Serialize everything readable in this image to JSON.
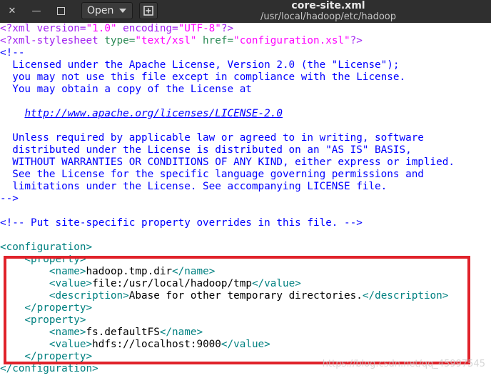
{
  "window": {
    "title": "core-site.xml",
    "path": "/usr/local/hadoop/etc/hadoop",
    "open_label": "Open",
    "icons": {
      "close": "close-icon",
      "minimize": "minimize-icon",
      "maximize": "maximize-icon",
      "new_tab": "new-document-icon"
    }
  },
  "code": {
    "l1": {
      "a": "<?xml version=",
      "b": "\"1.0\"",
      "c": " encoding=",
      "d": "\"UTF-8\"",
      "e": "?>"
    },
    "l2": {
      "a": "<?xml-stylesheet ",
      "b": "type=",
      "c": "\"text/xsl\"",
      "d": " href=",
      "e": "\"configuration.xsl\"",
      "f": "?>"
    },
    "l3": "<!--",
    "l4": "  Licensed under the Apache License, Version 2.0 (the \"License\");",
    "l5": "  you may not use this file except in compliance with the License.",
    "l6": "  You may obtain a copy of the License at",
    "l7": "",
    "l8": {
      "pre": "    ",
      "link": "http://www.apache.org/licenses/LICENSE-2.0"
    },
    "l9": "",
    "l10": "  Unless required by applicable law or agreed to in writing, software",
    "l11": "  distributed under the License is distributed on an \"AS IS\" BASIS,",
    "l12": "  WITHOUT WARRANTIES OR CONDITIONS OF ANY KIND, either express or implied.",
    "l13": "  See the License for the specific language governing permissions and",
    "l14": "  limitations under the License. See accompanying LICENSE file.",
    "l15": "-->",
    "l16": "",
    "l17": "<!-- Put site-specific property overrides in this file. -->",
    "l18": "",
    "l19": "<configuration>",
    "l20": "    <property>",
    "l21": {
      "pre": "        ",
      "open": "<name>",
      "val": "hadoop.tmp.dir",
      "close": "</name>"
    },
    "l22": {
      "pre": "        ",
      "open": "<value>",
      "val": "file:/usr/local/hadoop/tmp",
      "close": "</value>"
    },
    "l23": {
      "pre": "        ",
      "open": "<description>",
      "val": "Abase for other temporary directories.",
      "close": "</description>"
    },
    "l24": "    </property>",
    "l25": "    <property>",
    "l26": {
      "pre": "        ",
      "open": "<name>",
      "val": "fs.defaultFS",
      "close": "</name>"
    },
    "l27": {
      "pre": "        ",
      "open": "<value>",
      "val": "hdfs://localhost:9000",
      "close": "</value>"
    },
    "l28": "    </property>",
    "l29": "</configuration>"
  },
  "watermark": "https://blog.csdn.net/qq_45997545",
  "colors": {
    "highlight_border": "#e0222a",
    "tag": "#008080",
    "comment": "#0000ff",
    "string": "#ff00ff",
    "pi": "#a020f0"
  }
}
